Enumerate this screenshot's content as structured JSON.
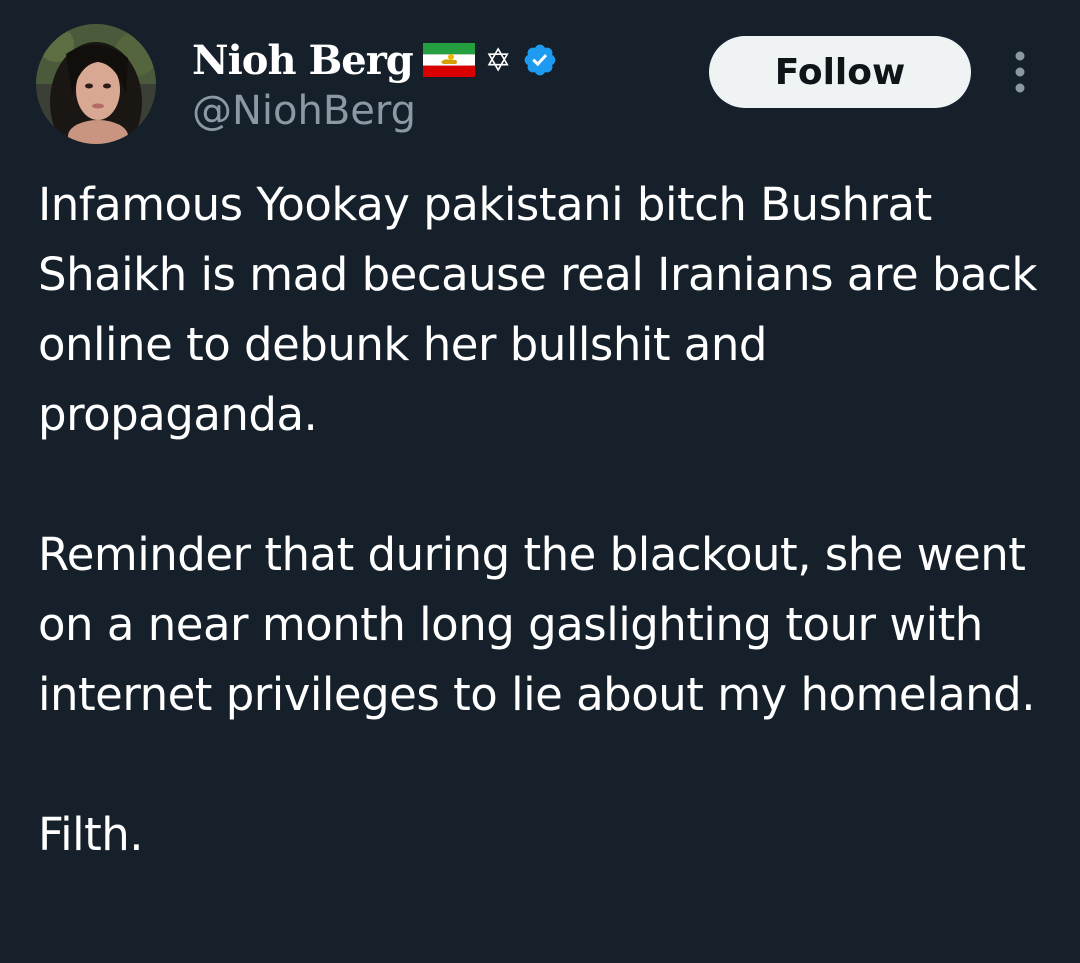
{
  "author": {
    "display_name": "Nioh Berg",
    "handle": "@NiohBerg",
    "flag_icon": "iran-lion-and-sun-flag-icon",
    "star_icon": "star-of-david-icon",
    "star_glyph": "✡",
    "verified_icon": "verified-badge-icon",
    "verified_color": "#1d9bf0"
  },
  "follow_button": {
    "label": "Follow"
  },
  "more_icon": "more-vertical-icon",
  "tweet": {
    "paragraphs": [
      "Infamous Yookay pakistani bitch Bushrat Shaikh is mad because real Iranians are back online to debunk her bullshit and propaganda.",
      "Reminder that during the blackout, she went on a near month long gaslighting tour with internet privileges to lie about my homeland.",
      "Filth."
    ]
  },
  "colors": {
    "background": "#15202b",
    "text_primary": "#ffffff",
    "text_secondary": "#8b98a5",
    "button_bg": "#eff3f4",
    "button_text": "#0f1419"
  }
}
